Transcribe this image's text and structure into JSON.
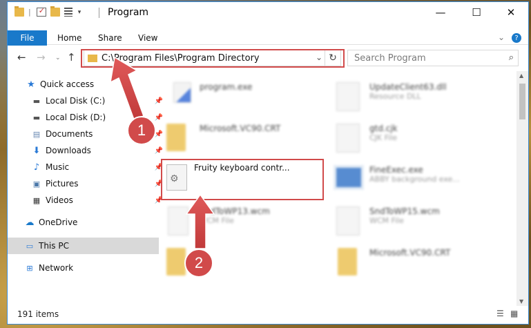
{
  "window": {
    "title": "Program",
    "controls": {
      "minimize": "—",
      "maximize": "☐",
      "close": "✕"
    }
  },
  "ribbon": {
    "file": "File",
    "tabs": [
      "Home",
      "Share",
      "View"
    ],
    "expand_icon": "chevron-down-icon",
    "help_icon": "help-icon"
  },
  "nav": {
    "address": "C:\\Program Files\\Program Directory",
    "search_placeholder": "Search Program"
  },
  "sidebar": {
    "items": [
      {
        "label": "Quick access",
        "icon": "star-icon"
      },
      {
        "label": "Local Disk (C:)",
        "icon": "drive-icon",
        "pinned": true
      },
      {
        "label": "Local Disk (D:)",
        "icon": "drive-icon",
        "pinned": true
      },
      {
        "label": "Documents",
        "icon": "documents-icon",
        "pinned": true
      },
      {
        "label": "Downloads",
        "icon": "download-icon",
        "pinned": true
      },
      {
        "label": "Music",
        "icon": "music-icon",
        "pinned": true
      },
      {
        "label": "Pictures",
        "icon": "pictures-icon",
        "pinned": true
      },
      {
        "label": "Videos",
        "icon": "videos-icon",
        "pinned": true
      },
      {
        "label": "OneDrive",
        "icon": "cloud-icon"
      },
      {
        "label": "This PC",
        "icon": "computer-icon",
        "selected": true
      },
      {
        "label": "Network",
        "icon": "network-icon"
      }
    ]
  },
  "files": [
    {
      "name": "program.exe",
      "sub": "",
      "icon": "exe-icon"
    },
    {
      "name": "UpdateClient63.dll",
      "sub": "Resource DLL",
      "icon": "dll-icon"
    },
    {
      "name": "Microsoft.VC90.CRT",
      "sub": "",
      "icon": "folder-icon"
    },
    {
      "name": "gtd.cjk",
      "sub": "CJK File",
      "icon": "file-icon"
    },
    {
      "name": "Fruity keyboard contr...",
      "sub": "",
      "icon": "gear-file-icon"
    },
    {
      "name": "FineExec.exe",
      "sub": "ABBY background exe...",
      "icon": "exe-icon"
    },
    {
      "name": "SndToWP13.wcm",
      "sub": "WCM File",
      "icon": "file-icon"
    },
    {
      "name": "SndToWP15.wcm",
      "sub": "WCM File",
      "icon": "file-icon"
    },
    {
      "name": "...",
      "sub": "",
      "icon": "folder-icon"
    },
    {
      "name": "Microsoft.VC90.CRT",
      "sub": "",
      "icon": "folder-icon"
    }
  ],
  "status": {
    "count": "191 items"
  },
  "annotations": {
    "step1": "1",
    "step2": "2",
    "color": "#d14a4a"
  }
}
